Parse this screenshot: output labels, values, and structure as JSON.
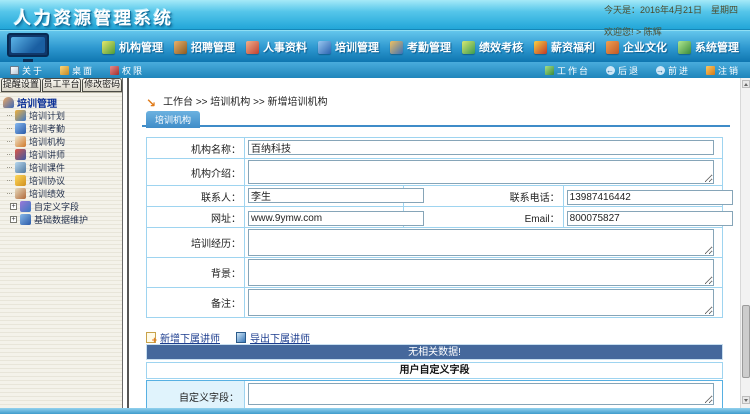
{
  "window": {
    "title": "人力资源管理系统",
    "date_text": "今天是：2016年4月21日　星期四",
    "welcome_text": "欢迎您! > 陈辉"
  },
  "nav": {
    "items": [
      {
        "label": "机构管理",
        "icon": "org-management-icon"
      },
      {
        "label": "招聘管理",
        "icon": "recruitment-icon"
      },
      {
        "label": "人事资料",
        "icon": "personnel-files-icon"
      },
      {
        "label": "培训管理",
        "icon": "training-management-icon"
      },
      {
        "label": "考勤管理",
        "icon": "attendance-icon"
      },
      {
        "label": "绩效考核",
        "icon": "performance-icon"
      },
      {
        "label": "薪资福利",
        "icon": "salary-benefits-icon"
      },
      {
        "label": "企业文化",
        "icon": "company-culture-icon"
      },
      {
        "label": "系统管理",
        "icon": "system-management-icon"
      }
    ]
  },
  "toolbar": {
    "about": "关于",
    "desktop": "桌面",
    "permission": "权限",
    "workbench": "工作台",
    "back": "后退",
    "forward": "前进",
    "logout": "注销"
  },
  "quick_tabs": [
    "提醒设置",
    "员工平台",
    "修改密码"
  ],
  "sidebar": {
    "section_title": "培训管理",
    "items": [
      {
        "label": "培训计划"
      },
      {
        "label": "培训考勤"
      },
      {
        "label": "培训机构"
      },
      {
        "label": "培训讲师"
      },
      {
        "label": "培训课件"
      },
      {
        "label": "培训协议"
      },
      {
        "label": "培训绩效"
      }
    ],
    "expandable_items": [
      {
        "label": "自定义字段"
      },
      {
        "label": "基础数据维护"
      }
    ]
  },
  "breadcrumb": {
    "text": "工作台 >> 培训机构 >> 新增培训机构"
  },
  "page_tab": {
    "label": "培训机构"
  },
  "form": {
    "org_name_label": "机构名称：",
    "org_name_value": "百纳科技",
    "org_intro_label": "机构介绍：",
    "org_intro_value": "",
    "contact_label": "联系人：",
    "contact_value": "李生",
    "phone_label": "联系电话：",
    "phone_value": "13987416442",
    "website_label": "网址：",
    "website_value": "www.9ymw.com",
    "email_label": "Email：",
    "email_value": "800075827",
    "experience_label": "培训经历：",
    "experience_value": "",
    "background_label": "背景：",
    "background_value": "",
    "remark_label": "备注：",
    "remark_value": "",
    "custom_field_label": "自定义字段：",
    "custom_field_value": ""
  },
  "teacher_actions": {
    "add_label": "新增下属讲师",
    "export_label": "导出下属讲师"
  },
  "teacher_table": {
    "empty_text": "无相关数据!"
  },
  "custom_section": {
    "title": "用户自定义字段"
  },
  "colors": {
    "banner_top": "#a5e9f8",
    "banner_bottom": "#22a6d8",
    "nav_top": "#63c6ec",
    "nav_bottom": "#0f76b0",
    "table_border": "#57b0e2",
    "label_cell_bg": "#e0f3fc",
    "no_data_bar_bg": "#45689c",
    "page_tab_bg": "#3f8cc8",
    "sidebar_bg": "#f4f2ea"
  }
}
